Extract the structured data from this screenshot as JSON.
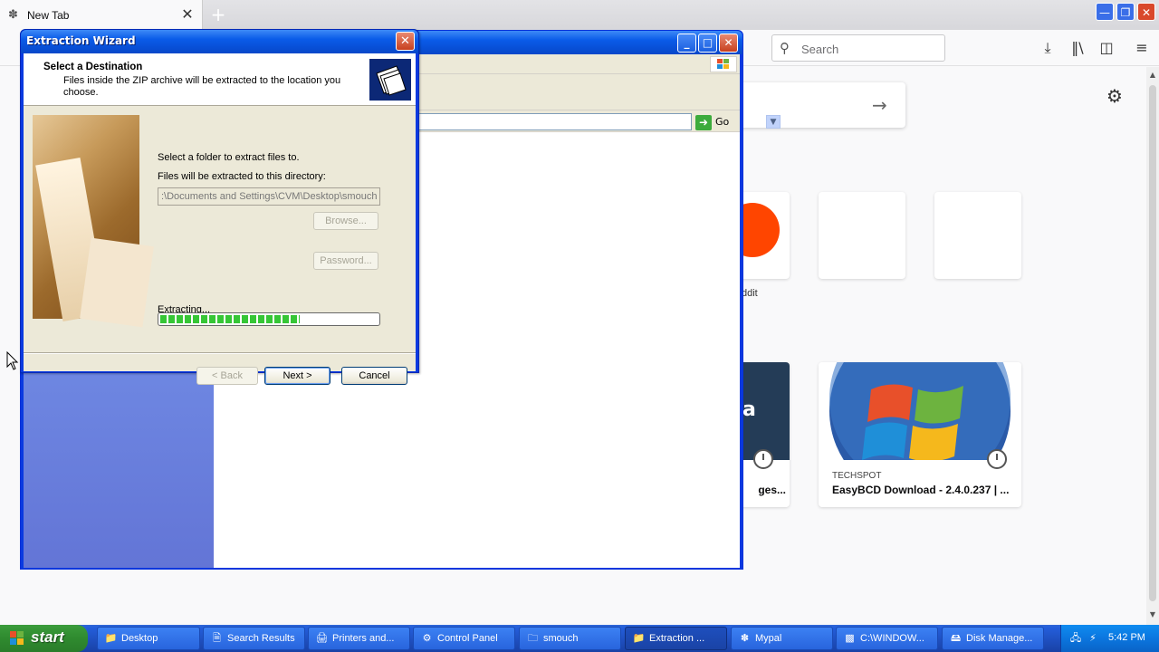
{
  "browser": {
    "tab_title": "New Tab",
    "tab_icon": "firefox-tab-icon",
    "search_placeholder": "Search",
    "toolbar_icons": [
      "download-icon",
      "library-icon",
      "sidebar-icon",
      "menu-icon"
    ],
    "newtab": {
      "topsite_reddit_label": "ddit",
      "card_left_title": "ges...",
      "card_left_letter": "a",
      "card_techspot_source": "TECHSPOT",
      "card_techspot_title": "EasyBCD Download - 2.4.0.237 | ..."
    }
  },
  "explorer": {
    "go_label": "Go"
  },
  "wizard": {
    "title": "Extraction Wizard",
    "header_title": "Select a Destination",
    "header_subtitle": "Files inside the ZIP archive will be extracted to the location you choose.",
    "select_folder_label": "Select a folder to extract files to.",
    "directory_label": "Files will be extracted to this directory:",
    "destination_value": ":\\Documents and Settings\\CVM\\Desktop\\smouch",
    "browse_label": "Browse...",
    "password_label": "Password...",
    "extracting_label": "Extracting...",
    "progress_fraction": 0.64,
    "back_label": "< Back",
    "next_label": "Next >",
    "cancel_label": "Cancel"
  },
  "taskbar": {
    "start_label": "start",
    "tasks": [
      {
        "label": "Desktop",
        "icon": "folder-icon"
      },
      {
        "label": "Search Results",
        "icon": "search-results-icon"
      },
      {
        "label": "Printers and...",
        "icon": "printer-icon"
      },
      {
        "label": "Control Panel",
        "icon": "control-panel-icon"
      },
      {
        "label": "smouch",
        "icon": "zip-folder-icon"
      },
      {
        "label": "Extraction ...",
        "icon": "folder-icon"
      },
      {
        "label": "Mypal",
        "icon": "mypal-icon"
      },
      {
        "label": "C:\\WINDOW...",
        "icon": "cmd-icon"
      },
      {
        "label": "Disk Manage...",
        "icon": "disk-management-icon"
      }
    ],
    "clock": "5:42 PM"
  },
  "colors": {
    "xp_blue": "#0a5be8",
    "start_green": "#2f8a2f",
    "progress_green": "#36c636",
    "reddit_orange": "#ff4500"
  }
}
